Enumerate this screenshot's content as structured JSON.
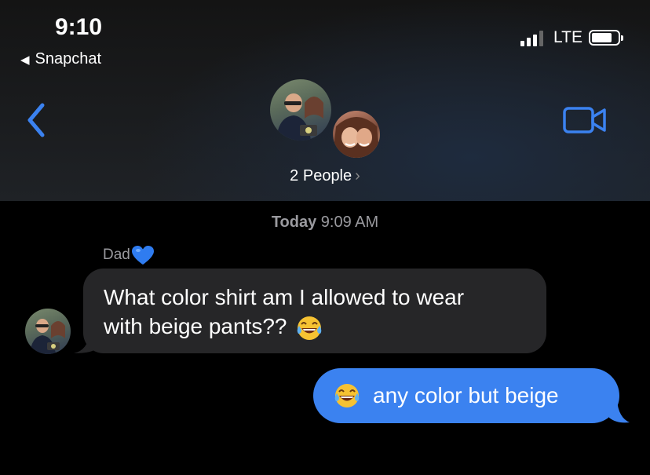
{
  "status_bar": {
    "time": "9:10",
    "back_app": "Snapchat",
    "network": "LTE",
    "signal_bars": 3,
    "signal_bars_total": 4
  },
  "header": {
    "back_icon": "chevron-left-icon",
    "video_icon": "video-camera-icon",
    "group_label": "2 People",
    "group_chevron": "›"
  },
  "conversation": {
    "timestamp_day": "Today",
    "timestamp_time": "9:09 AM",
    "incoming": {
      "sender": "Dad",
      "sender_emoji": "blue-heart-icon",
      "text_line1": "What color shirt am I allowed to wear",
      "text_line2": "with beige pants??",
      "emoji": "tears-of-joy-icon"
    },
    "outgoing": {
      "emoji": "tears-of-joy-icon",
      "text": "any color but beige"
    }
  },
  "colors": {
    "accent": "#3b82f0",
    "incoming_bubble": "#262628",
    "outgoing_bubble": "#3b82f0",
    "meta_text": "#9a9a9f"
  }
}
